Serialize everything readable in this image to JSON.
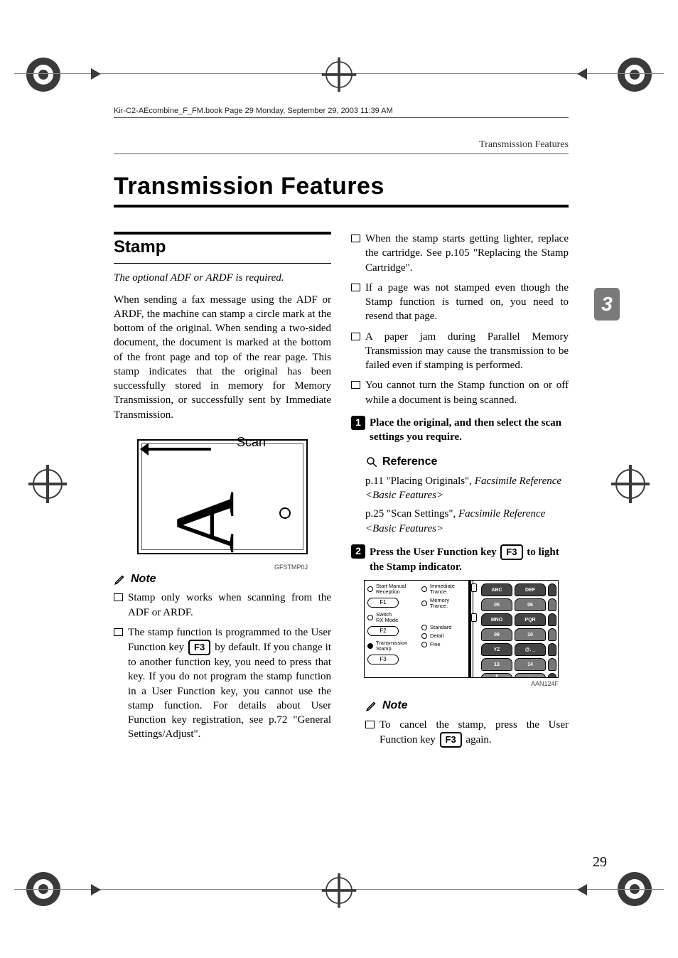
{
  "meta": {
    "book_page_header": "Kir-C2-AEcombine_F_FM.book  Page 29  Monday, September 29, 2003  11:39 AM",
    "running_head": "Transmission Features",
    "page_number": "29",
    "chapter_tab": "3"
  },
  "title": "Transmission Features",
  "left": {
    "section_heading": "Stamp",
    "requirement_italic": "The optional ADF or ARDF is required.",
    "intro": "When sending a fax message using the ADF or ARDF, the machine can stamp a circle mark at the bottom of the original. When sending a two-sided document, the document is marked at the bottom of the front page and top of the rear page. This stamp indicates that the original has been successfully stored in memory for Memory Transmission, or successfully sent by Immediate Transmission.",
    "scan_label": "Scan",
    "scan_code": "GFSTMP0J",
    "note_label": "Note",
    "notes": [
      "Stamp only works when scanning from the ADF or ARDF."
    ],
    "note2_pre": "The stamp function is programmed to the User Function key ",
    "note2_key": "F3",
    "note2_post": " by default. If you change it to another function key, you need to press that key. If you do not program the stamp function in a User Function key, you cannot use the stamp function. For details about User Function key registration, see p.72 \"General Settings/Adjust\"."
  },
  "right": {
    "top_notes": [
      "When the stamp starts getting lighter, replace the cartridge. See p.105 \"Replacing the Stamp Cartridge\".",
      "If a page was not stamped even though the Stamp function is turned on, you need to resend that page.",
      "A paper jam during Parallel Memory Transmission may cause the transmission to be failed even if stamping is performed.",
      "You cannot turn the Stamp function on or off while a document is being scanned."
    ],
    "step1_num": "1",
    "step1_text": "Place the original, and then select the scan settings you require.",
    "reference_label": "Reference",
    "ref1_pre": "p.11 \"Placing Originals\", ",
    "ref1_ital": "Facsimile Reference <Basic Features>",
    "ref2_pre": "p.25 \"Scan Settings\", ",
    "ref2_ital": "Facsimile Reference <Basic Features>",
    "step2_num": "2",
    "step2_pre": "Press the User Function key ",
    "step2_key": "F3",
    "step2_post": " to light the Stamp indicator.",
    "panel": {
      "left_rows": [
        {
          "led": false,
          "label1": "Start Manual",
          "label2": "Reception"
        },
        {
          "led": false,
          "label1": "Switch",
          "label2": "RX Mode"
        },
        {
          "led": true,
          "label1": "Transmission",
          "label2": "Stamp"
        }
      ],
      "mid_rows": [
        {
          "led": false,
          "label1": "Immediate",
          "label2": "Trance."
        },
        {
          "led": false,
          "label1": "Memory",
          "label2": "Trance."
        },
        {
          "led": false,
          "label1": "Standard",
          "label2": ""
        },
        {
          "led": false,
          "label1": "Detail",
          "label2": ""
        },
        {
          "led": false,
          "label1": "Fine",
          "label2": ""
        }
      ],
      "fnkeys": [
        "F1",
        "F2",
        "F3"
      ],
      "keypad": [
        [
          {
            "t1": "ABC",
            "t2": ""
          },
          {
            "t1": "DEF",
            "t2": ""
          },
          {
            "t1": "",
            "t2": ""
          }
        ],
        [
          {
            "t1": "05",
            "t2": ""
          },
          {
            "t1": "06",
            "t2": ""
          },
          {
            "t1": "",
            "t2": ""
          }
        ],
        [
          {
            "t1": "MNO",
            "t2": ""
          },
          {
            "t1": "PQR",
            "t2": ""
          },
          {
            "t1": "",
            "t2": ""
          }
        ],
        [
          {
            "t1": "09",
            "t2": ""
          },
          {
            "t1": "10",
            "t2": ""
          },
          {
            "t1": "",
            "t2": ""
          }
        ],
        [
          {
            "t1": "YZ",
            "t2": ""
          },
          {
            "t1": "@. _",
            "t2": ""
          },
          {
            "t1": "",
            "t2": ""
          }
        ],
        [
          {
            "t1": "13",
            "t2": ""
          },
          {
            "t1": "14",
            "t2": ""
          },
          {
            "t1": "",
            "t2": ""
          }
        ]
      ],
      "bottom_keys": {
        "left": "Shift",
        "mid": "Space",
        "right": ""
      },
      "code": "AAN124F"
    },
    "note_label": "Note",
    "bottom_note_pre": "To cancel the stamp, press the User Function key ",
    "bottom_note_key": "F3",
    "bottom_note_post": " again."
  }
}
